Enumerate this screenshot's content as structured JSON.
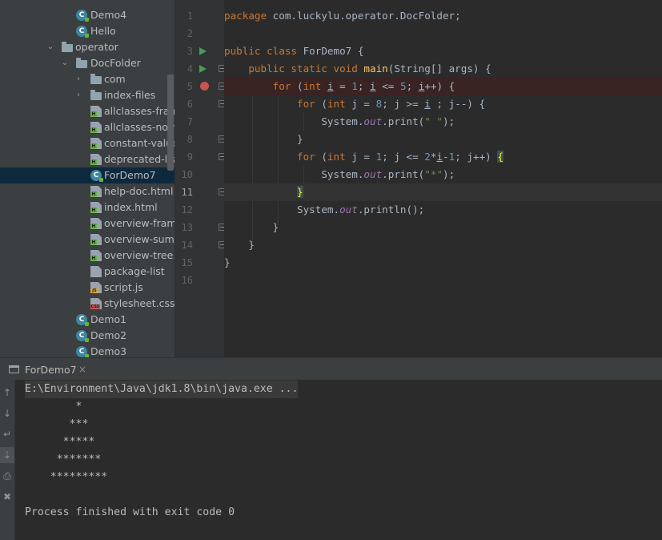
{
  "project_tree": {
    "items": [
      {
        "label": "Demo4",
        "icon": "class-icon"
      },
      {
        "label": "Hello",
        "icon": "class-icon"
      },
      {
        "label": "operator",
        "icon": "folder-icon",
        "expanded": true
      },
      {
        "label": "DocFolder",
        "icon": "folder-icon",
        "expanded": true
      },
      {
        "label": "com",
        "icon": "folder-icon",
        "expanded": false
      },
      {
        "label": "index-files",
        "icon": "folder-icon",
        "expanded": false
      },
      {
        "label": "allclasses-frame.html",
        "icon": "html-file-icon"
      },
      {
        "label": "allclasses-noframe.html",
        "icon": "html-file-icon"
      },
      {
        "label": "constant-values.html",
        "icon": "html-file-icon"
      },
      {
        "label": "deprecated-list.html",
        "icon": "html-file-icon"
      },
      {
        "label": "ForDemo7",
        "icon": "class-icon",
        "selected": true
      },
      {
        "label": "help-doc.html",
        "icon": "html-file-icon"
      },
      {
        "label": "index.html",
        "icon": "html-file-icon"
      },
      {
        "label": "overview-frame.html",
        "icon": "html-file-icon"
      },
      {
        "label": "overview-summary.html",
        "icon": "html-file-icon"
      },
      {
        "label": "overview-tree.html",
        "icon": "html-file-icon"
      },
      {
        "label": "package-list",
        "icon": "text-file-icon"
      },
      {
        "label": "script.js",
        "icon": "js-file-icon"
      },
      {
        "label": "stylesheet.css",
        "icon": "css-file-icon"
      },
      {
        "label": "Demo1",
        "icon": "class-icon"
      },
      {
        "label": "Demo2",
        "icon": "class-icon"
      },
      {
        "label": "Demo3",
        "icon": "class-icon"
      }
    ]
  },
  "editor": {
    "line_numbers": [
      "1",
      "2",
      "3",
      "4",
      "5",
      "6",
      "7",
      "8",
      "9",
      "10",
      "11",
      "12",
      "13",
      "14",
      "15",
      "16"
    ],
    "current_line": "11",
    "breakpoint_line": "5",
    "run_gutter_lines": [
      "3",
      "4"
    ],
    "code": {
      "l1_kw": "package",
      "l1_rest": " com.luckylu.operator.DocFolder;",
      "l3_kw": "public class",
      "l3_rest": " ForDemo7 {",
      "l4_indent": "    ",
      "l4_kw": "public static void",
      "l4_sp": " ",
      "l4_fn": "main",
      "l4_rest": "(String[] args) {",
      "l5_indent": "        ",
      "l5_for": "for",
      "l5_a": " (",
      "l5_int": "int",
      "l5_sp": " ",
      "l5_i1": "i",
      "l5_b": " = ",
      "l5_n1": "1",
      "l5_c": "; ",
      "l5_i2": "i",
      "l5_d": " <= ",
      "l5_n5": "5",
      "l5_e": "; ",
      "l5_i3": "i",
      "l5_f": "++) {",
      "l6_indent": "            ",
      "l6_for": "for",
      "l6_a": " (",
      "l6_int": "int",
      "l6_b": " j = ",
      "l6_n8": "8",
      "l6_c": "; j >= ",
      "l6_i": "i",
      "l6_d": " ; j--) {",
      "l7_indent": "                ",
      "l7_a": "System.",
      "l7_out": "out",
      "l7_b": ".print(",
      "l7_str": "\" \"",
      "l7_c": ");",
      "l8_indent": "            ",
      "l8_text": "}",
      "l9_indent": "            ",
      "l9_for": "for",
      "l9_a": " (",
      "l9_int": "int",
      "l9_b": " j = ",
      "l9_n1": "1",
      "l9_c": "; j <= ",
      "l9_n2": "2",
      "l9_d": "*",
      "l9_i": "i",
      "l9_e": "-",
      "l9_n1b": "1",
      "l9_f": "; j++) ",
      "l9_brace": "{",
      "l10_indent": "                ",
      "l10_a": "System.",
      "l10_out": "out",
      "l10_b": ".print(",
      "l10_str": "\"*\"",
      "l10_c": ");",
      "l11_indent": "            ",
      "l11_brace": "}",
      "l12_indent": "            ",
      "l12_a": "System.",
      "l12_out": "out",
      "l12_b": ".println();",
      "l13_indent": "        ",
      "l13_text": "}",
      "l14_indent": "    ",
      "l14_text": "}",
      "l15_text": "}"
    }
  },
  "run_panel": {
    "tab_label": "ForDemo7",
    "tab_close": "×",
    "command": "E:\\Environment\\Java\\jdk1.8\\bin\\java.exe ...",
    "output": [
      "        *",
      "       ***",
      "      *****",
      "     *******",
      "    *********"
    ],
    "exit_message": "Process finished with exit code 0",
    "tools": [
      "up-arrow-icon",
      "down-arrow-icon",
      "soft-wrap-icon",
      "scroll-to-end-icon",
      "print-icon",
      "trash-icon"
    ]
  }
}
